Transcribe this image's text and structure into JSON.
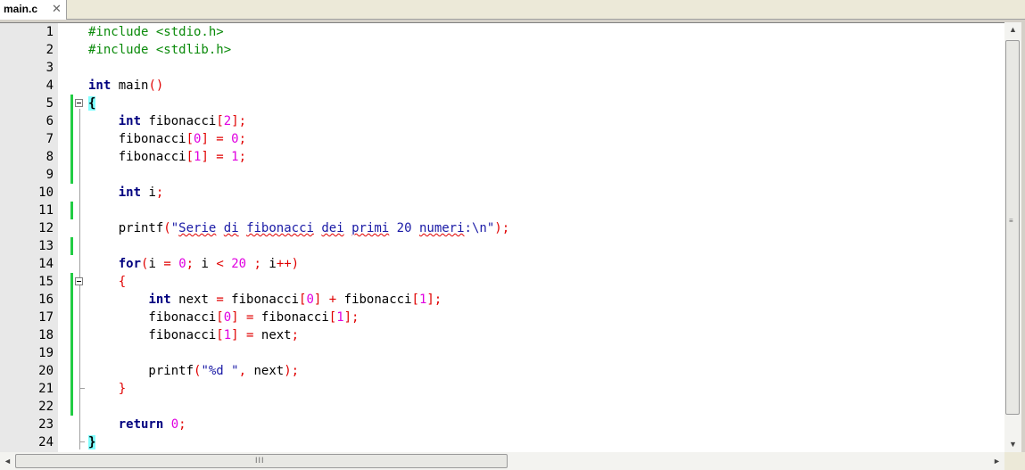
{
  "tab": {
    "label": "main.c",
    "close": "✕"
  },
  "lines": [
    {
      "n": "1",
      "segs": [
        {
          "t": "#include <stdio.h>",
          "c": "pp"
        }
      ]
    },
    {
      "n": "2",
      "segs": [
        {
          "t": "#include <stdlib.h>",
          "c": "pp"
        }
      ]
    },
    {
      "n": "3",
      "segs": []
    },
    {
      "n": "4",
      "segs": [
        {
          "t": "int",
          "c": "kw"
        },
        {
          "t": " main"
        },
        {
          "t": "()",
          "c": "op"
        }
      ]
    },
    {
      "n": "5",
      "segs": [
        {
          "t": "{",
          "c": "brace-hl"
        }
      ]
    },
    {
      "n": "6",
      "segs": [
        {
          "t": "    "
        },
        {
          "t": "int",
          "c": "kw"
        },
        {
          "t": " fibonacci"
        },
        {
          "t": "[",
          "c": "op"
        },
        {
          "t": "2",
          "c": "num"
        },
        {
          "t": "];",
          "c": "op"
        }
      ]
    },
    {
      "n": "7",
      "segs": [
        {
          "t": "    fibonacci"
        },
        {
          "t": "[",
          "c": "op"
        },
        {
          "t": "0",
          "c": "num"
        },
        {
          "t": "] = ",
          "c": "op"
        },
        {
          "t": "0",
          "c": "num"
        },
        {
          "t": ";",
          "c": "op"
        }
      ]
    },
    {
      "n": "8",
      "segs": [
        {
          "t": "    fibonacci"
        },
        {
          "t": "[",
          "c": "op"
        },
        {
          "t": "1",
          "c": "num"
        },
        {
          "t": "] = ",
          "c": "op"
        },
        {
          "t": "1",
          "c": "num"
        },
        {
          "t": ";",
          "c": "op"
        }
      ]
    },
    {
      "n": "9",
      "segs": []
    },
    {
      "n": "10",
      "segs": [
        {
          "t": "    "
        },
        {
          "t": "int",
          "c": "kw"
        },
        {
          "t": " i"
        },
        {
          "t": ";",
          "c": "op"
        }
      ]
    },
    {
      "n": "11",
      "segs": []
    },
    {
      "n": "12",
      "segs": [
        {
          "t": "    printf"
        },
        {
          "t": "(",
          "c": "op"
        },
        {
          "t": "\"",
          "c": "str"
        },
        {
          "t": "Serie",
          "c": "str spell"
        },
        {
          "t": " ",
          "c": "str"
        },
        {
          "t": "di",
          "c": "str spell"
        },
        {
          "t": " ",
          "c": "str"
        },
        {
          "t": "fibonacci",
          "c": "str spell"
        },
        {
          "t": " ",
          "c": "str"
        },
        {
          "t": "dei",
          "c": "str spell"
        },
        {
          "t": " ",
          "c": "str"
        },
        {
          "t": "primi",
          "c": "str spell"
        },
        {
          "t": " 20 ",
          "c": "str"
        },
        {
          "t": "numeri",
          "c": "str spell"
        },
        {
          "t": ":\\n\"",
          "c": "str"
        },
        {
          "t": ");",
          "c": "op"
        }
      ]
    },
    {
      "n": "13",
      "segs": []
    },
    {
      "n": "14",
      "segs": [
        {
          "t": "    "
        },
        {
          "t": "for",
          "c": "kw"
        },
        {
          "t": "(",
          "c": "op"
        },
        {
          "t": "i "
        },
        {
          "t": "=",
          "c": "op"
        },
        {
          "t": " "
        },
        {
          "t": "0",
          "c": "num"
        },
        {
          "t": ";",
          "c": "op"
        },
        {
          "t": " i "
        },
        {
          "t": "<",
          "c": "op"
        },
        {
          "t": " "
        },
        {
          "t": "20",
          "c": "num"
        },
        {
          "t": " ; ",
          "c": "op"
        },
        {
          "t": "i"
        },
        {
          "t": "++)",
          "c": "op"
        }
      ]
    },
    {
      "n": "15",
      "segs": [
        {
          "t": "    "
        },
        {
          "t": "{",
          "c": "op"
        }
      ]
    },
    {
      "n": "16",
      "segs": [
        {
          "t": "        "
        },
        {
          "t": "int",
          "c": "kw"
        },
        {
          "t": " next "
        },
        {
          "t": "=",
          "c": "op"
        },
        {
          "t": " fibonacci"
        },
        {
          "t": "[",
          "c": "op"
        },
        {
          "t": "0",
          "c": "num"
        },
        {
          "t": "] + ",
          "c": "op"
        },
        {
          "t": "fibonacci"
        },
        {
          "t": "[",
          "c": "op"
        },
        {
          "t": "1",
          "c": "num"
        },
        {
          "t": "];",
          "c": "op"
        }
      ]
    },
    {
      "n": "17",
      "segs": [
        {
          "t": "        fibonacci"
        },
        {
          "t": "[",
          "c": "op"
        },
        {
          "t": "0",
          "c": "num"
        },
        {
          "t": "] = ",
          "c": "op"
        },
        {
          "t": "fibonacci"
        },
        {
          "t": "[",
          "c": "op"
        },
        {
          "t": "1",
          "c": "num"
        },
        {
          "t": "];",
          "c": "op"
        }
      ]
    },
    {
      "n": "18",
      "segs": [
        {
          "t": "        fibonacci"
        },
        {
          "t": "[",
          "c": "op"
        },
        {
          "t": "1",
          "c": "num"
        },
        {
          "t": "] = ",
          "c": "op"
        },
        {
          "t": "next"
        },
        {
          "t": ";",
          "c": "op"
        }
      ]
    },
    {
      "n": "19",
      "segs": []
    },
    {
      "n": "20",
      "segs": [
        {
          "t": "        printf"
        },
        {
          "t": "(",
          "c": "op"
        },
        {
          "t": "\"%d \"",
          "c": "str"
        },
        {
          "t": ", ",
          "c": "op"
        },
        {
          "t": "next"
        },
        {
          "t": ");",
          "c": "op"
        }
      ]
    },
    {
      "n": "21",
      "segs": [
        {
          "t": "    "
        },
        {
          "t": "}",
          "c": "op"
        }
      ]
    },
    {
      "n": "22",
      "segs": []
    },
    {
      "n": "23",
      "segs": [
        {
          "t": "    "
        },
        {
          "t": "return",
          "c": "kw"
        },
        {
          "t": " "
        },
        {
          "t": "0",
          "c": "num"
        },
        {
          "t": ";",
          "c": "op"
        }
      ]
    },
    {
      "n": "24",
      "segs": [
        {
          "t": "}",
          "c": "brace-hl"
        }
      ]
    }
  ],
  "scrollbar": {
    "v_up": "▲",
    "v_down": "▼",
    "v_grip": "≡",
    "h_left": "◄",
    "h_right": "►",
    "h_grip": "III"
  },
  "colors": {
    "preprocessor": "#0a8a0a",
    "keyword": "#00007f",
    "operator": "#e00000",
    "number": "#e000e0",
    "string": "#1a1aa6",
    "brace_highlight": "#80ffff",
    "change_bar": "#22cc44"
  }
}
